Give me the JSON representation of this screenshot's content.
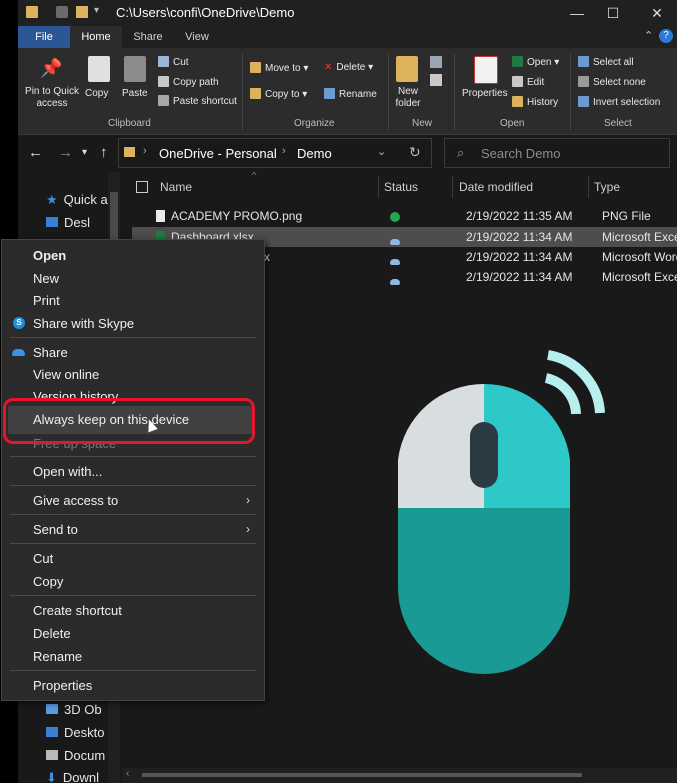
{
  "window": {
    "title": "C:\\Users\\confi\\OneDrive\\Demo",
    "controls": {
      "minimize": "—",
      "maximize": "☐",
      "close": "✕"
    }
  },
  "ribbon": {
    "tabs": [
      "File",
      "Home",
      "Share",
      "View"
    ],
    "clipboard": {
      "label": "Clipboard",
      "pin": "Pin to Quick access",
      "copy": "Copy",
      "paste": "Paste",
      "cut": "Cut",
      "copy_path": "Copy path",
      "paste_shortcut": "Paste shortcut"
    },
    "organize": {
      "label": "Organize",
      "move_to": "Move to",
      "copy_to": "Copy to",
      "delete": "Delete",
      "rename": "Rename"
    },
    "new": {
      "label": "New",
      "new_folder": "New folder"
    },
    "open": {
      "label": "Open",
      "properties": "Properties",
      "open": "Open",
      "edit": "Edit",
      "history": "History"
    },
    "select": {
      "label": "Select",
      "select_all": "Select all",
      "select_none": "Select none",
      "invert": "Invert selection"
    }
  },
  "address": {
    "crumbs": [
      "OneDrive - Personal",
      "Demo"
    ],
    "search_placeholder": "Search Demo"
  },
  "nav_pane": {
    "items": [
      "Quick ac",
      "Desl",
      "3D Ob",
      "Deskto",
      "Docum",
      "Downl"
    ]
  },
  "file_list": {
    "columns": [
      "Name",
      "Status",
      "Date modified",
      "Type"
    ],
    "rows": [
      {
        "name": "ACADEMY PROMO.png",
        "status": "synced",
        "date": "2/19/2022 11:35 AM",
        "type": "PNG File"
      },
      {
        "name": "Dashboard.xlsx",
        "status": "cloud",
        "date": "2/19/2022 11:34 AM",
        "type": "Microsoft Exce"
      },
      {
        "name": "x",
        "status": "cloud",
        "date": "2/19/2022 11:34 AM",
        "type": "Microsoft Word"
      },
      {
        "name": "",
        "status": "cloud",
        "date": "2/19/2022 11:34 AM",
        "type": "Microsoft Exce"
      }
    ]
  },
  "context_menu": {
    "open": "Open",
    "new": "New",
    "print": "Print",
    "share_skype": "Share with Skype",
    "share": "Share",
    "view_online": "View online",
    "version_history": "Version history",
    "always_keep": "Always keep on this device",
    "free_up": "Free up space",
    "open_with": "Open with...",
    "give_access": "Give access to",
    "send_to": "Send to",
    "cut": "Cut",
    "copy": "Copy",
    "create_shortcut": "Create shortcut",
    "delete": "Delete",
    "rename": "Rename",
    "properties": "Properties"
  },
  "colors": {
    "accent": "#2b5797",
    "highlight_box": "#e4152e",
    "mouse_teal": "#2ec8c8",
    "mouse_dark_teal": "#1a9a94",
    "mouse_grey": "#d8dde0"
  }
}
